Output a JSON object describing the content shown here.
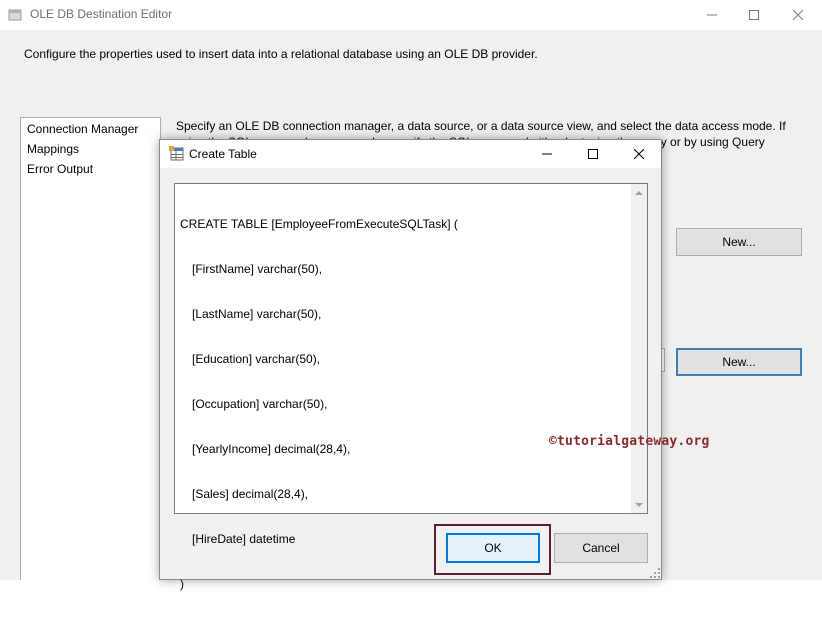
{
  "outer_window": {
    "title": "OLE DB Destination Editor",
    "description": "Configure the properties used to insert data into a relational database using an OLE DB provider.",
    "nav_items": [
      "Connection Manager",
      "Mappings",
      "Error Output"
    ],
    "right_description": "Specify an OLE DB connection manager, a data source, or a data source view, and select the data access mode. If using the SQL command access mode, specify the SQL command either by typing the query or by using Query Builder. For",
    "new_button_1": "New...",
    "new_button_2": "New..."
  },
  "dialog": {
    "title": "Create Table",
    "sql_lines": [
      "CREATE TABLE [EmployeeFromExecuteSQLTask] (",
      "[FirstName] varchar(50),",
      "[LastName] varchar(50),",
      "[Education] varchar(50),",
      "[Occupation] varchar(50),",
      "[YearlyIncome] decimal(28,4),",
      "[Sales] decimal(28,4),",
      "[HireDate] datetime",
      ")"
    ],
    "ok_label": "OK",
    "cancel_label": "Cancel"
  },
  "watermark": "©tutorialgateway.org",
  "colors": {
    "dialog_bg": "#f0f0f0",
    "ok_border": "#0078d7",
    "highlight_border": "#5a1e37",
    "watermark": "#8a2c2c"
  },
  "icons": [
    "app-icon",
    "minimize-icon",
    "maximize-icon",
    "close-icon",
    "table-icon",
    "scroll-up-icon",
    "scroll-down-icon",
    "resize-grip-icon"
  ]
}
